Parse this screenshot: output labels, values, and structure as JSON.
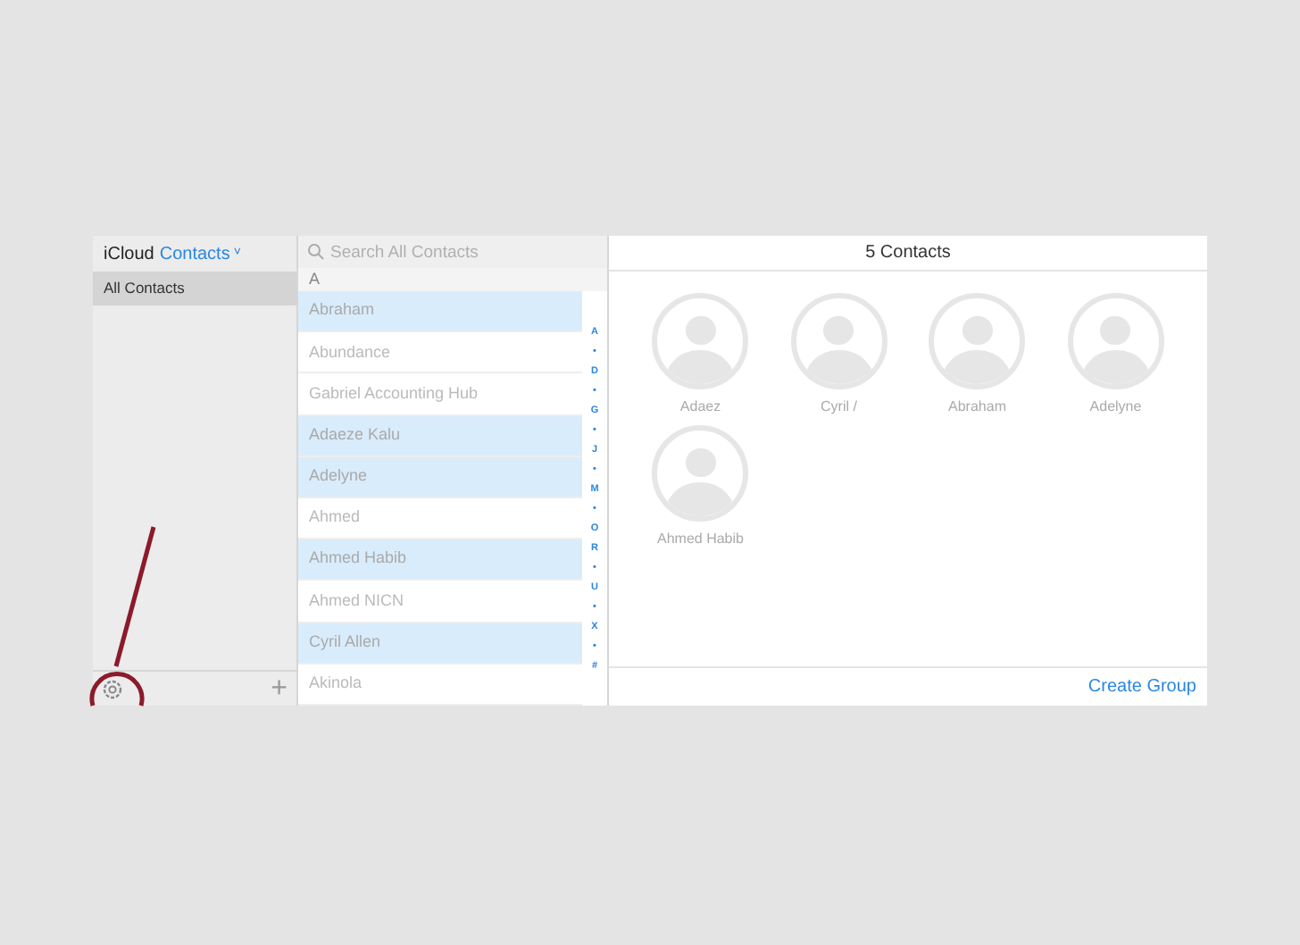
{
  "sidebar": {
    "title_prefix": "iCloud",
    "title_app": "Contacts",
    "caret": "˅",
    "groups": [
      {
        "label": "All Contacts",
        "selected": true
      }
    ]
  },
  "search": {
    "placeholder": "Search All Contacts"
  },
  "list": {
    "section": "A",
    "rows": [
      {
        "name": "Abraham",
        "selected": true
      },
      {
        "name": "Abundance",
        "selected": false
      },
      {
        "name": "Gabriel Accounting Hub",
        "selected": false
      },
      {
        "name": "Adaeze Kalu",
        "selected": true
      },
      {
        "name": "Adelyne",
        "selected": true
      },
      {
        "name": "Ahmed",
        "selected": false
      },
      {
        "name": "Ahmed Habib",
        "selected": true
      },
      {
        "name": "Ahmed NICN",
        "selected": false
      },
      {
        "name": "Cyril Allen",
        "selected": true
      },
      {
        "name": "Akinola",
        "selected": false
      }
    ],
    "index": [
      "A",
      "•",
      "D",
      "•",
      "G",
      "•",
      "J",
      "•",
      "M",
      "•",
      "O",
      "R",
      "•",
      "U",
      "•",
      "X",
      "•",
      "#"
    ]
  },
  "detail": {
    "title": "5 Contacts",
    "cards": [
      {
        "name": "Adaez"
      },
      {
        "name": "Cyril /"
      },
      {
        "name": "Abraham"
      },
      {
        "name": "Adelyne"
      },
      {
        "name": "Ahmed Habib"
      }
    ],
    "create_group": "Create Group"
  },
  "footer": {
    "add": "+"
  }
}
